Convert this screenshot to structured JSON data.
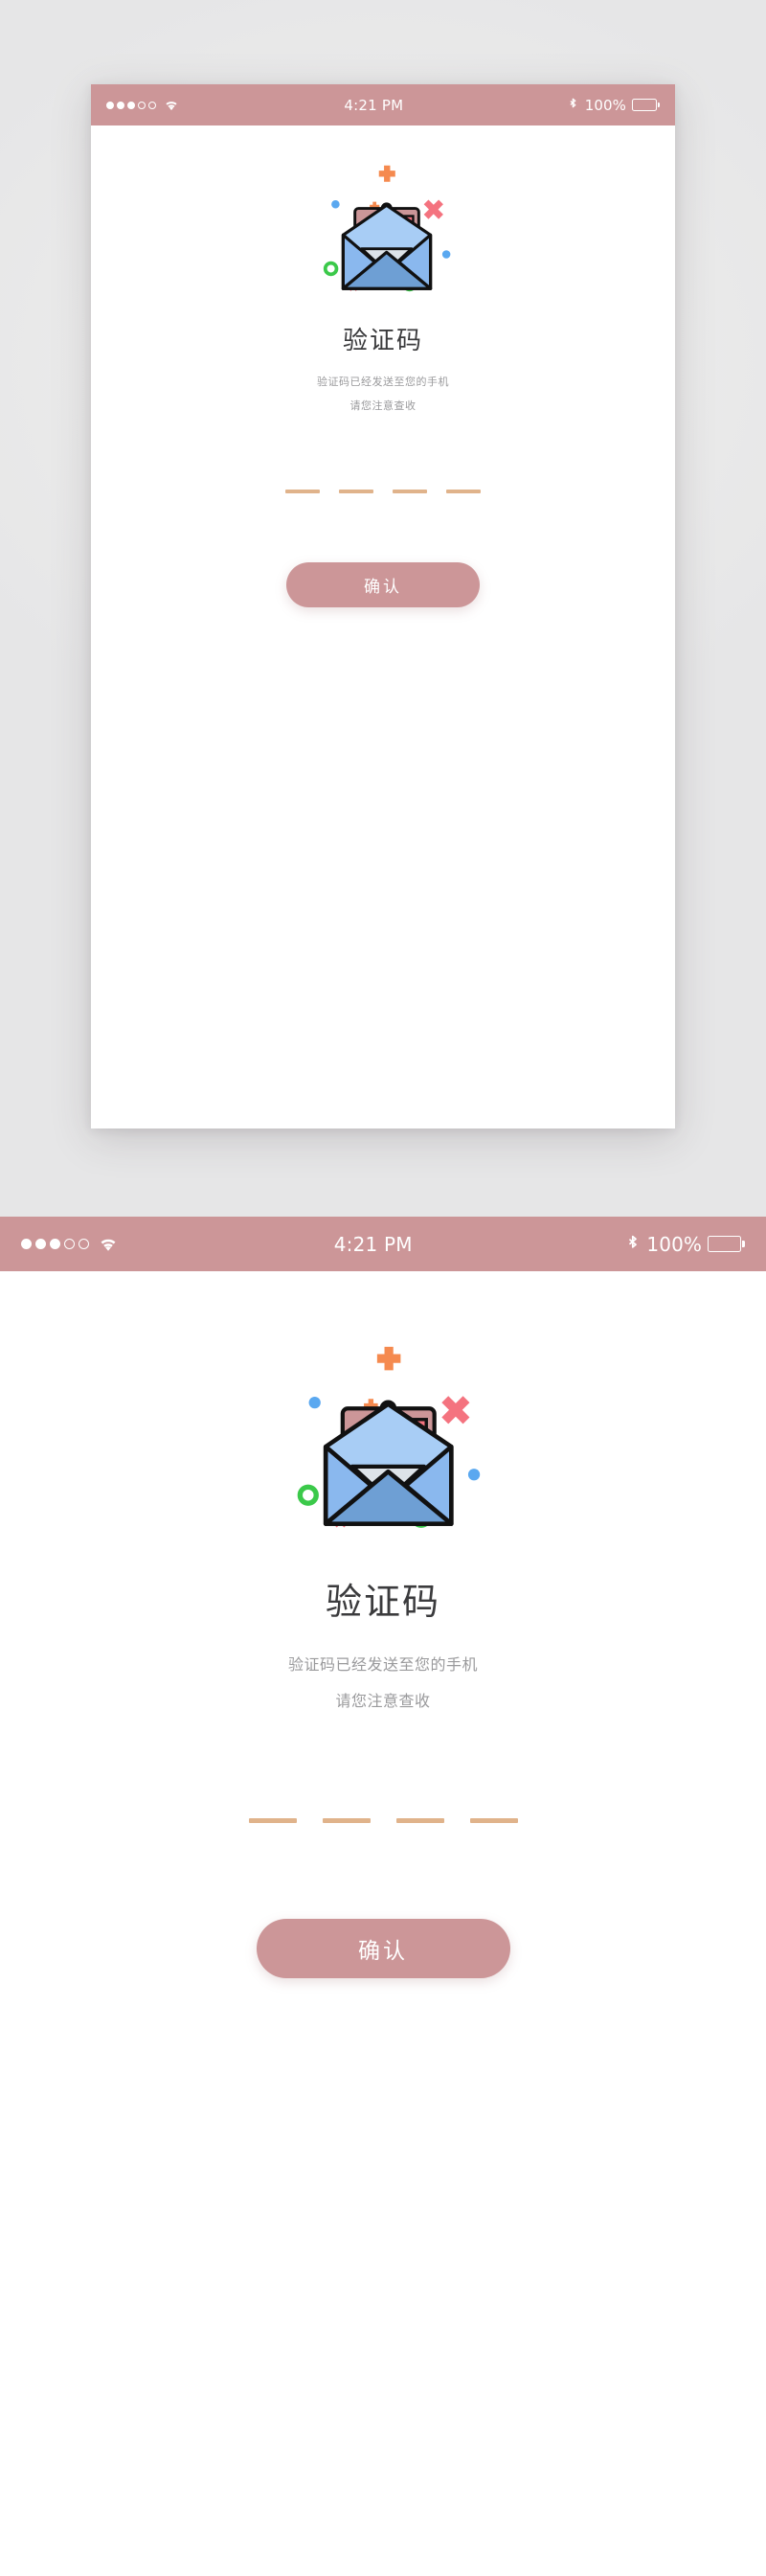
{
  "app": {
    "screen_name": "验证码",
    "background_color": "#ececec",
    "accent_color": "#cc9698",
    "dash_color": "#e0b38b",
    "card_background": "#ffffff"
  },
  "status_bar": {
    "signal_icon": "signal-dots-icon",
    "signal_dots_filled": 3,
    "signal_dots_total": 5,
    "wifi_icon": "wifi-icon",
    "time": "4:21 PM",
    "bluetooth_icon": "bluetooth-icon",
    "battery_percent": "100%",
    "battery_icon": "battery-full-icon",
    "background_color": "#cc9698",
    "text_color": "#ffffff"
  },
  "content": {
    "illustration_name": "open-envelope-with-chart-letter-illustration",
    "title": "验证码",
    "subtitle_line1": "验证码已经发送至您的手机",
    "subtitle_line2": "请您注意查收",
    "code_input": {
      "name": "verification-code-input",
      "slots": 4,
      "values": [
        "",
        "",
        "",
        ""
      ],
      "placeholder": ""
    },
    "confirm_button": {
      "label": "确认",
      "background_color": "#cc9698",
      "text_color": "#ffffff"
    }
  },
  "illustration_colors": {
    "envelope_front": "#6e9fd4",
    "envelope_flap_left": "#8ab8ee",
    "envelope_flap_right": "#8ab8ee",
    "envelope_inner": "#a8cdf5",
    "letter_card": "#cc9698",
    "letter_white": "#dde3e8",
    "bar_yellow": "#f7e04d",
    "bar_blue": "#6ec6f5",
    "bar_orange": "#f79c56",
    "bar_red": "#f4737f",
    "deco_orange_plus": "#f58a4f",
    "deco_red_x": "#f4737f",
    "deco_green_circle": "#3bc94a",
    "deco_blue_dot": "#5aa8f0",
    "outline": "#111111"
  }
}
